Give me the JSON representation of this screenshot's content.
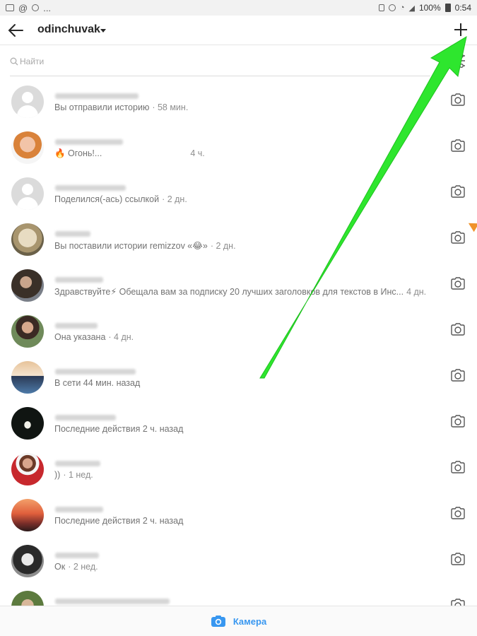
{
  "status_bar": {
    "battery_text": "100%",
    "time": "0:54"
  },
  "header": {
    "username": "odinchuvak"
  },
  "search": {
    "placeholder": "Найти"
  },
  "conversations": [
    {
      "avatar": "default",
      "name_width": 118,
      "text": "Вы отправили историю",
      "time": "· 58 мин."
    },
    {
      "avatar": "woman-redhair",
      "name_width": 96,
      "text": "🔥 Огонь!...",
      "time": "4 ч."
    },
    {
      "avatar": "default",
      "name_width": 100,
      "text": "Поделился(-ась) ссылкой",
      "time": "· 2 дн."
    },
    {
      "avatar": "dog",
      "name_width": 50,
      "text": "Вы поставили истории remizzov «😂»",
      "time": "· 2 дн."
    },
    {
      "avatar": "woman-dark",
      "name_width": 68,
      "text": "Здравствуйте⚡  Обещала вам за подписку 20 лучших заголовков для текстов в Инс...",
      "time": "4 дн."
    },
    {
      "avatar": "woman-outdoor",
      "name_width": 60,
      "text": "Она указана",
      "time": "· 4 дн."
    },
    {
      "avatar": "beach-person",
      "name_width": 114,
      "text": "В сети 44 мин. назад",
      "time": ""
    },
    {
      "avatar": "dark-silhouette",
      "name_width": 86,
      "text": "Последние действия 2 ч. назад",
      "time": ""
    },
    {
      "avatar": "woman-red-shirt",
      "name_width": 64,
      "text": "))",
      "time": "· 1 нед."
    },
    {
      "avatar": "sunset",
      "name_width": 68,
      "text": "Последние действия 2 ч. назад",
      "time": ""
    },
    {
      "avatar": "woman-bw",
      "name_width": 62,
      "text": "Ок",
      "time": "· 2 нед."
    },
    {
      "avatar": "woman-green",
      "name_width": 162,
      "text": "",
      "time": ""
    }
  ],
  "bottom_bar": {
    "camera_label": "Камера"
  },
  "colors": {
    "accent": "#3897f0",
    "arrow": "#2ee62e",
    "orange": "#f0932b"
  }
}
